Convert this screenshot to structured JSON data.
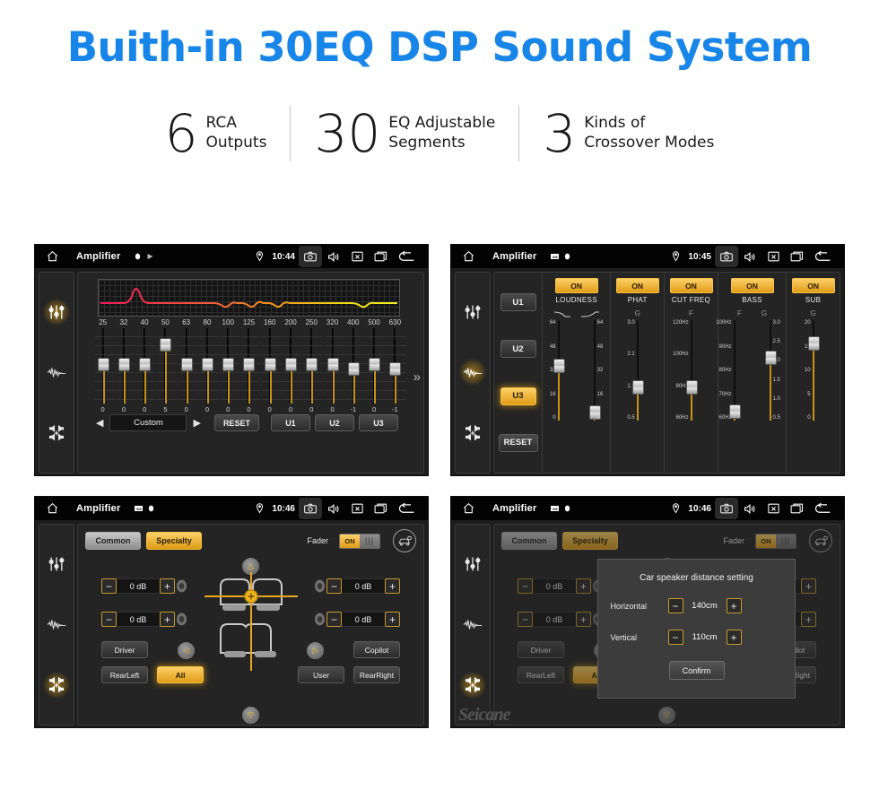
{
  "header": {
    "title": "Buith-in 30EQ DSP Sound System",
    "title_color": "#1886e8",
    "stats": [
      {
        "number": "6",
        "text": "RCA\nOutputs"
      },
      {
        "number": "30",
        "text": "EQ Adjustable\nSegments"
      },
      {
        "number": "3",
        "text": "Kinds of\nCrossover Modes"
      }
    ]
  },
  "statusbar": {
    "app_title": "Amplifier",
    "times": {
      "p1": "10:44",
      "p2": "10:45",
      "p3": "10:46",
      "p4": "10:46"
    },
    "icons": [
      "home-icon",
      "location-pin-icon",
      "camera-icon",
      "volume-icon",
      "close-box-icon",
      "recents-icon",
      "back-arrow-icon"
    ]
  },
  "sidebar": {
    "items": [
      {
        "name": "equalizer-icon",
        "label": "Equalizer"
      },
      {
        "name": "waveform-icon",
        "label": "Crossover"
      },
      {
        "name": "balance-icon",
        "label": "Balance"
      }
    ]
  },
  "panel_eq": {
    "frequencies": [
      "25",
      "32",
      "40",
      "50",
      "63",
      "80",
      "100",
      "125",
      "160",
      "200",
      "250",
      "320",
      "400",
      "500",
      "630"
    ],
    "values": [
      "0",
      "0",
      "0",
      "5",
      "0",
      "0",
      "0",
      "0",
      "0",
      "0",
      "0",
      "0",
      "-1",
      "0",
      "-1"
    ],
    "preset_name": "Custom",
    "prev_label": "◀",
    "next_label": "▶",
    "reset_label": "RESET",
    "user_presets": [
      "U1",
      "U2",
      "U3"
    ],
    "more_label": "»"
  },
  "panel_crossover": {
    "presets": [
      "U1",
      "U2",
      "U3"
    ],
    "active_preset": "U3",
    "reset_label": "RESET",
    "columns": [
      {
        "name": "LOUDNESS",
        "state": "ON",
        "sliders": [
          {
            "param": "",
            "scale": [
              "64",
              "48",
              "32",
              "16",
              "0"
            ],
            "value_pct": 50
          },
          {
            "param": "",
            "scale": [
              "64",
              "48",
              "32",
              "16",
              "0"
            ],
            "value_pct": 4
          }
        ]
      },
      {
        "name": "PHAT",
        "state": "ON",
        "sliders": [
          {
            "param": "G",
            "scale": [
              "3.0",
              "2.1",
              "1.3",
              "0.5"
            ],
            "value_pct": 29
          }
        ]
      },
      {
        "name": "CUT FREQ",
        "state": "ON",
        "sliders": [
          {
            "param": "F",
            "scale": [
              "120Hz",
              "100Hz",
              "80Hz",
              "60Hz"
            ],
            "value_pct": 29
          }
        ]
      },
      {
        "name": "BASS",
        "state": "ON",
        "sliders": [
          {
            "param": "F",
            "scale": [
              "100Hz",
              "90Hz",
              "80Hz",
              "70Hz",
              "60Hz"
            ],
            "value_pct": 5
          },
          {
            "param": "G",
            "scale": [
              "3.0",
              "2.5",
              "2.0",
              "1.5",
              "1.0",
              "0.5"
            ],
            "value_pct": 58
          }
        ]
      },
      {
        "name": "SUB",
        "state": "ON",
        "sliders": [
          {
            "param": "G",
            "scale": [
              "20",
              "15",
              "10",
              "5",
              "0"
            ],
            "value_pct": 73
          }
        ]
      }
    ]
  },
  "panel_balance": {
    "tabs": [
      {
        "label": "Common",
        "selected": false
      },
      {
        "label": "Specialty",
        "selected": true
      }
    ],
    "fader_label": "Fader",
    "fader_state": "ON",
    "db_values": [
      "0 dB",
      "0 dB",
      "0 dB",
      "0 dB"
    ],
    "minus_label": "−",
    "plus_label": "+",
    "position_buttons": [
      {
        "label": "Driver",
        "active": false
      },
      {
        "label": "Copilot",
        "active": false
      },
      {
        "label": "RearLeft",
        "active": false
      },
      {
        "label": "All",
        "active": true
      },
      {
        "label": "User",
        "active": false
      },
      {
        "label": "RearRight",
        "active": false
      }
    ],
    "nav_arrows": [
      "△",
      "◁",
      "▷",
      "▽"
    ]
  },
  "dialog": {
    "title": "Car speaker distance setting",
    "rows": [
      {
        "label": "Horizontal",
        "value": "140cm"
      },
      {
        "label": "Vertical",
        "value": "110cm"
      }
    ],
    "confirm_label": "Confirm",
    "minus_label": "−",
    "plus_label": "+"
  },
  "watermark": {
    "text": "Seicane"
  }
}
